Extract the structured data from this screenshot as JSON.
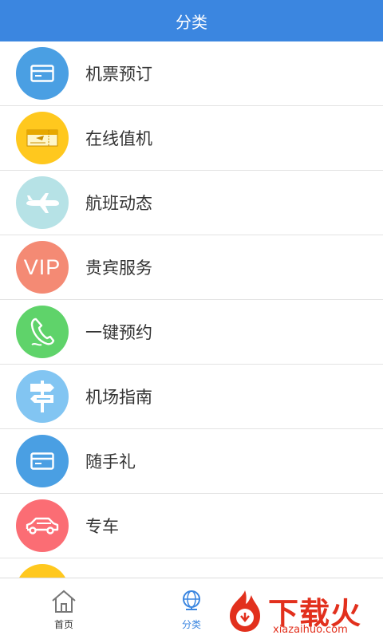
{
  "header": {
    "title": "分类"
  },
  "list": {
    "items": [
      {
        "label": "机票预订",
        "icon": "card-icon",
        "color": "#4a9fe3"
      },
      {
        "label": "在线值机",
        "icon": "boarding-pass-icon",
        "color": "#ffc81e"
      },
      {
        "label": "航班动态",
        "icon": "airplane-icon",
        "color": "#b6e2e6"
      },
      {
        "label": "贵宾服务",
        "icon": "vip-icon",
        "color": "#f48a74",
        "icon_text": "VIP"
      },
      {
        "label": "一键预约",
        "icon": "phone-icon",
        "color": "#5fd36a"
      },
      {
        "label": "机场指南",
        "icon": "signpost-icon",
        "color": "#82c5f2"
      },
      {
        "label": "随手礼",
        "icon": "card-icon",
        "color": "#4a9fe3"
      },
      {
        "label": "专车",
        "icon": "car-icon",
        "color": "#fb6d74"
      },
      {
        "label": "",
        "icon": "partial-icon",
        "color": "#ffc81e"
      }
    ]
  },
  "tabbar": {
    "home_label": "首页",
    "category_label": "分类",
    "active_color": "#3b86e0"
  },
  "watermark": {
    "text": "下载火",
    "sub": "xiazaihuo.com"
  }
}
